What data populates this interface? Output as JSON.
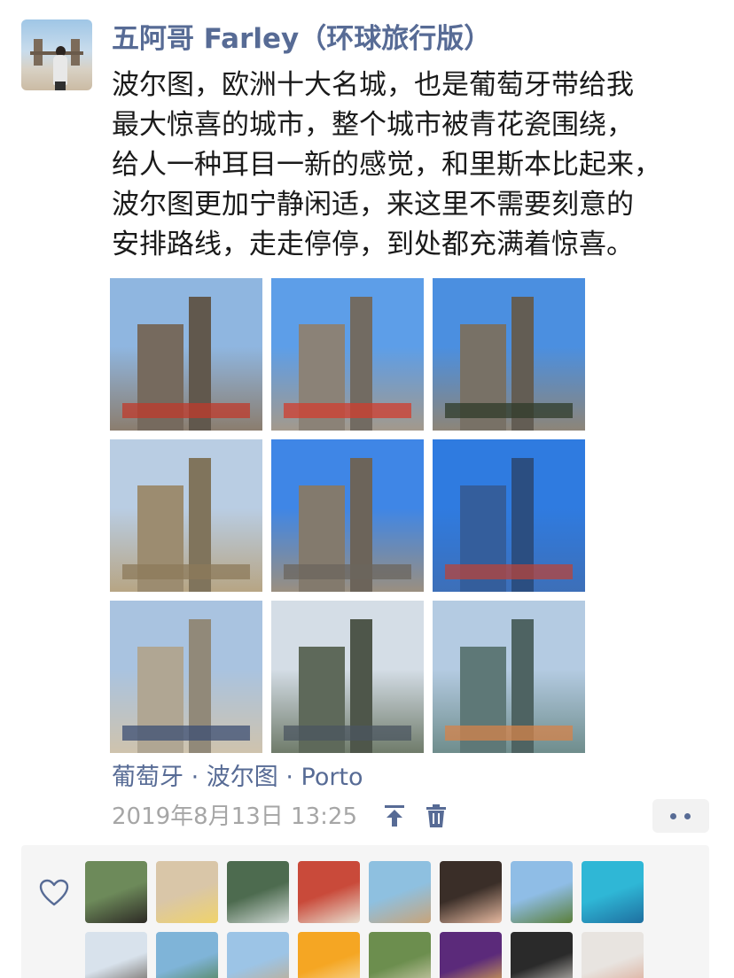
{
  "post": {
    "author": "五阿哥 Farley（环球旅行版）",
    "text_lines": [
      "波尔图，欧洲十大名城，也是葡萄牙带给我",
      "最大惊喜的城市，整个城市被青花瓷围绕，",
      "给人一种耳目一新的感觉，和里斯本比起来，",
      "波尔图更加宁静闲适，来这里不需要刻意的",
      "安排路线，走走停停，到处都充满着惊喜。"
    ],
    "photos": [
      {
        "name": "photo-street",
        "sky": "#8fb6e0",
        "ground": "#8b7d6e",
        "accent": "#c0392b"
      },
      {
        "name": "photo-clerigos-street",
        "sky": "#5d9ee8",
        "ground": "#a3998c",
        "accent": "#d23c2e"
      },
      {
        "name": "photo-statue",
        "sky": "#4b8fe0",
        "ground": "#8d8578",
        "accent": "#2f3b2a"
      },
      {
        "name": "photo-ornate-building",
        "sky": "#b9cde3",
        "ground": "#b7a584",
        "accent": "#8c7a5a"
      },
      {
        "name": "photo-clerigos-tower",
        "sky": "#3f86e6",
        "ground": "#9a8f80",
        "accent": "#6b655d"
      },
      {
        "name": "photo-azulejo-church",
        "sky": "#2f7be0",
        "ground": "#3d6fb8",
        "accent": "#b8443a"
      },
      {
        "name": "photo-facade",
        "sky": "#a9c3e0",
        "ground": "#cfc3ad",
        "accent": "#3b4e73"
      },
      {
        "name": "photo-bridge",
        "sky": "#d4dde6",
        "ground": "#6f7b6a",
        "accent": "#4b5560"
      },
      {
        "name": "photo-riverside",
        "sky": "#b4cbe2",
        "ground": "#6f8d8c",
        "accent": "#d6834a"
      }
    ],
    "location": "葡萄牙 · 波尔图 · Porto",
    "timestamp": "2019年8月13日 13:25",
    "icons": {
      "pin": "pin-top-icon",
      "delete": "trash-icon",
      "more": "more-dots-icon",
      "like": "heart-icon"
    },
    "colors": {
      "link": "#576b95",
      "text": "#1a1a1a",
      "meta": "#a6a6a6",
      "likes_bg": "#f5f5f5"
    }
  },
  "likes": {
    "avatars": [
      {
        "name": "liker-1",
        "c1": "#6d8a5a",
        "c2": "#2d2a25"
      },
      {
        "name": "liker-2",
        "c1": "#d9c6a8",
        "c2": "#f0d36a"
      },
      {
        "name": "liker-3",
        "c1": "#4d6b4f",
        "c2": "#cfd8d4"
      },
      {
        "name": "liker-4",
        "c1": "#c94a3a",
        "c2": "#e8dfd0"
      },
      {
        "name": "liker-5",
        "c1": "#8ec0e0",
        "c2": "#c8a47a"
      },
      {
        "name": "liker-6",
        "c1": "#3a2e28",
        "c2": "#e6b9a0"
      },
      {
        "name": "liker-7",
        "c1": "#8fbde6",
        "c2": "#5b7f3a"
      },
      {
        "name": "liker-8",
        "c1": "#2fb7d6",
        "c2": "#1e6fa0"
      },
      {
        "name": "liker-9",
        "c1": "#d8e2ec",
        "c2": "#5c5248"
      },
      {
        "name": "liker-10",
        "c1": "#7fb4d8",
        "c2": "#4c7a3e"
      },
      {
        "name": "liker-11",
        "c1": "#9cc4e6",
        "c2": "#c7a97f"
      },
      {
        "name": "liker-12",
        "c1": "#f5a623",
        "c2": "#f7e3b5"
      },
      {
        "name": "liker-13",
        "c1": "#6c8e4e",
        "c2": "#e2d8c0"
      },
      {
        "name": "liker-14",
        "c1": "#5b2a7a",
        "c2": "#f0c14a"
      },
      {
        "name": "liker-15",
        "c1": "#2a2a2a",
        "c2": "#e0dcd6"
      },
      {
        "name": "liker-16",
        "c1": "#e8e4e0",
        "c2": "#d9a18a"
      }
    ]
  }
}
